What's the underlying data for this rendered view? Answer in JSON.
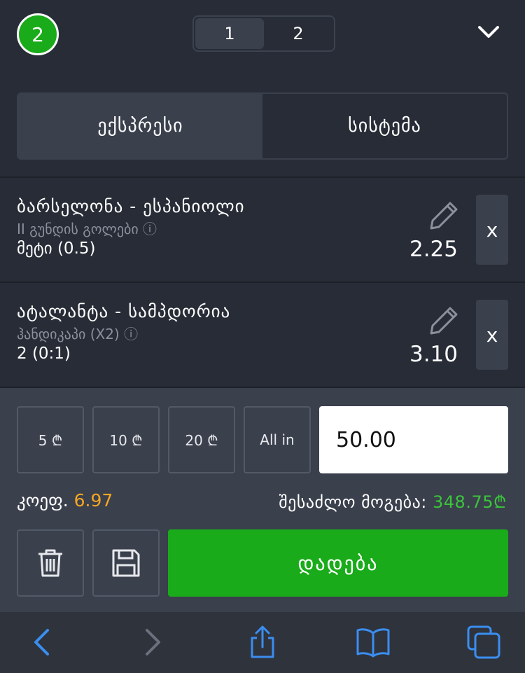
{
  "header": {
    "bet_count": "2",
    "pages": [
      "1",
      "2"
    ],
    "active_page": "1"
  },
  "bet_type_tabs": [
    "ექსპრესი",
    "სისტემა"
  ],
  "bets": [
    {
      "teams": "ბარსელონა - ესპანიოლი",
      "market": "II გუნდის გოლები ⓘ",
      "outcome": "მეტი (0.5)",
      "odds": "2.25",
      "remove": "x"
    },
    {
      "teams": "ატალანტა - სამპდორია",
      "market": "ჰანდიკაპი (X2) ⓘ",
      "outcome": "2 (0:1)",
      "odds": "3.10",
      "remove": "x"
    }
  ],
  "stake": {
    "chips": [
      "5 ₾",
      "10 ₾",
      "20 ₾",
      "All in"
    ],
    "amount": "50.00",
    "coef_label": "კოეფ.",
    "coef_value": "6.97",
    "win_label": "შესაძლო მოგება:",
    "win_value": "348.75₾",
    "place_label": "დადება"
  },
  "icons": {
    "pencil": "pencil-icon",
    "trash": "trash-icon",
    "save": "save-icon",
    "chevron": "chevron-down-icon"
  },
  "colors": {
    "accent_green": "#1aab1a",
    "coef_orange": "#f5a623",
    "win_green": "#3bc43b",
    "ios_blue": "#3b8ef0"
  }
}
